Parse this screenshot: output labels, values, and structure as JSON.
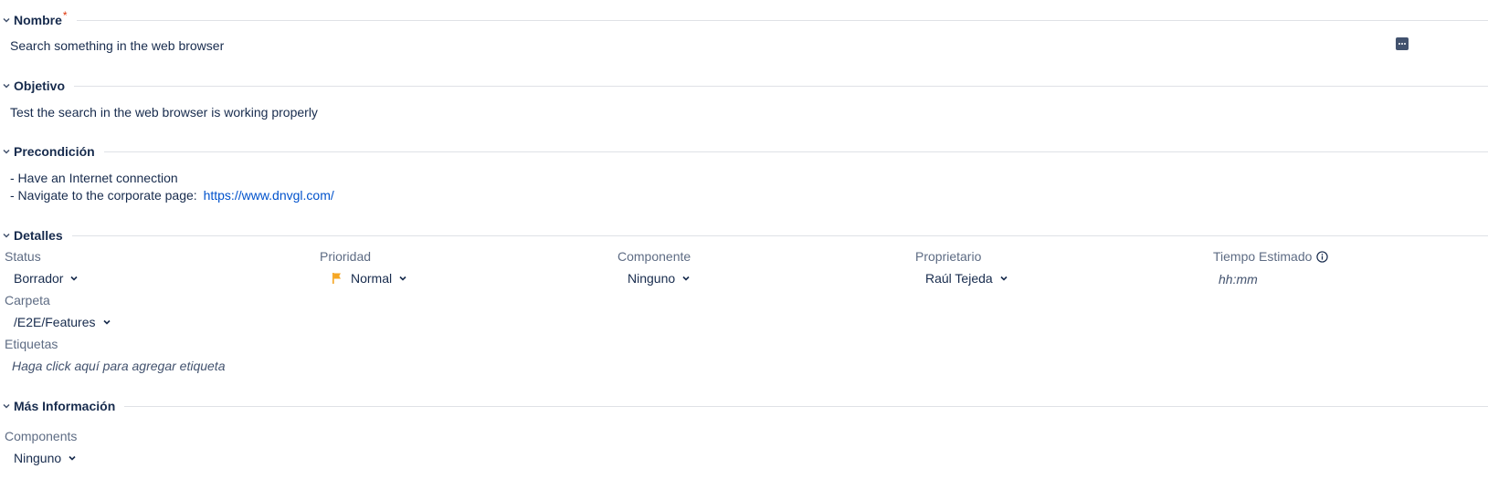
{
  "sections": {
    "nombre": {
      "title": "Nombre",
      "required_mark": "*",
      "value": "Search something in the web browser"
    },
    "objetivo": {
      "title": "Objetivo",
      "value": "Test the search in the web browser is working properly"
    },
    "precondicion": {
      "title": "Precondición",
      "line1": "- Have an Internet connection",
      "line2_prefix": "- Navigate to the corporate page: ",
      "link": "https://www.dnvgl.com/"
    },
    "detalles": {
      "title": "Detalles",
      "status": {
        "label": "Status",
        "value": "Borrador"
      },
      "prioridad": {
        "label": "Prioridad",
        "value": "Normal",
        "flag_color": "#f5a623"
      },
      "componente": {
        "label": "Componente",
        "value": "Ninguno"
      },
      "propietario": {
        "label": "Proprietario",
        "value": "Raúl Tejeda"
      },
      "tiempo": {
        "label": "Tiempo Estimado",
        "placeholder": "hh:mm"
      },
      "carpeta": {
        "label": "Carpeta",
        "value": "/E2E/Features"
      },
      "etiquetas": {
        "label": "Etiquetas",
        "placeholder": "Haga click aquí para agregar etiqueta"
      }
    },
    "mas_informacion": {
      "title": "Más Información",
      "components": {
        "label": "Components",
        "value": "Ninguno"
      }
    }
  },
  "icons": {
    "section_toggle": "chevron-down-icon",
    "dropdown": "chevron-down-icon",
    "more": "more-icon",
    "info": "info-icon",
    "priority": "flag-icon"
  },
  "colors": {
    "text": "#172b4d",
    "label": "#5e6c84",
    "link": "#0052cc",
    "required": "#de350b",
    "divider": "#dfe1e6"
  }
}
